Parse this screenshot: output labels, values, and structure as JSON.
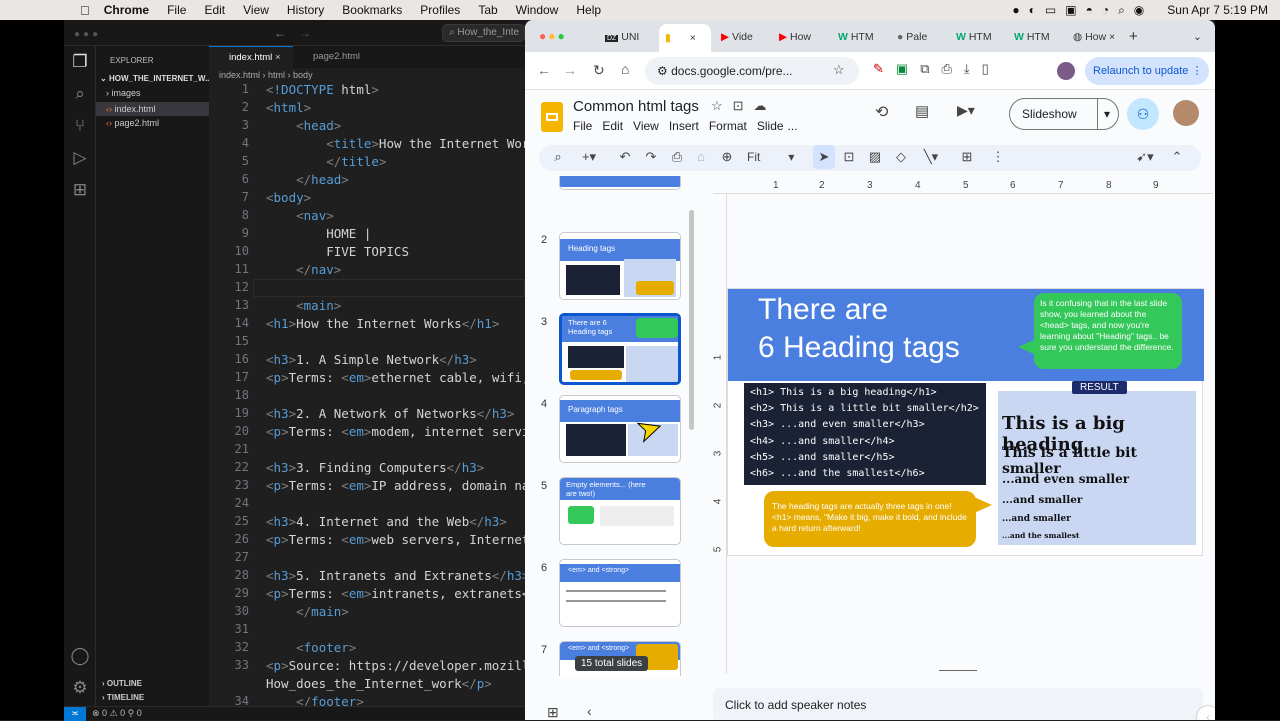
{
  "menubar": {
    "app": "Chrome",
    "items": [
      "File",
      "Edit",
      "View",
      "History",
      "Bookmarks",
      "Profiles",
      "Tab",
      "Window",
      "Help"
    ],
    "clock": "Sun Apr 7  5:19 PM"
  },
  "vscode": {
    "search": "How_the_Inte",
    "explorer_label": "EXPLORER",
    "folder": "HOW_THE_INTERNET_W...",
    "files": [
      "images",
      "index.html",
      "page2.html"
    ],
    "outline": "OUTLINE",
    "timeline": "TIMELINE",
    "tabs": [
      "index.html",
      "page2.html"
    ],
    "breadcrumb": [
      "index.html",
      "html",
      "body"
    ],
    "status": {
      "errors": "0",
      "warnings": "0",
      "ports": "0"
    },
    "lines": [
      {
        "n": "1",
        "t": "<!DOCTYPE html>"
      },
      {
        "n": "2",
        "t": "<html>"
      },
      {
        "n": "3",
        "t": "    <head>"
      },
      {
        "n": "4",
        "t": "        <title>How the Internet Work"
      },
      {
        "n": "5",
        "t": "        </title>"
      },
      {
        "n": "6",
        "t": "    </head>"
      },
      {
        "n": "7",
        "t": "<body>"
      },
      {
        "n": "8",
        "t": "    <nav>"
      },
      {
        "n": "9",
        "t": "        HOME |"
      },
      {
        "n": "10",
        "t": "        FIVE TOPICS"
      },
      {
        "n": "11",
        "t": "    </nav>"
      },
      {
        "n": "12",
        "t": ""
      },
      {
        "n": "13",
        "t": "    <main>"
      },
      {
        "n": "14",
        "t": "<h1>How the Internet Works</h1>"
      },
      {
        "n": "15",
        "t": ""
      },
      {
        "n": "16",
        "t": "<h3>1. A Simple Network</h3>"
      },
      {
        "n": "17",
        "t": "<p>Terms: <em>ethernet cable, wifi,"
      },
      {
        "n": "18",
        "t": ""
      },
      {
        "n": "19",
        "t": "<h3>2. A Network of Networks</h3>"
      },
      {
        "n": "20",
        "t": "<p>Terms: <em>modem, internet servic"
      },
      {
        "n": "21",
        "t": ""
      },
      {
        "n": "22",
        "t": "<h3>3. Finding Computers</h3>"
      },
      {
        "n": "23",
        "t": "<p>Terms: <em>IP address, domain nam"
      },
      {
        "n": "24",
        "t": ""
      },
      {
        "n": "25",
        "t": "<h3>4. Internet and the Web</h3>"
      },
      {
        "n": "26",
        "t": "<p>Terms: <em>web servers, Internet,"
      },
      {
        "n": "27",
        "t": ""
      },
      {
        "n": "28",
        "t": "<h3>5. Intranets and Extranets</h3>"
      },
      {
        "n": "29",
        "t": "<p>Terms: <em>intranets, extranets</"
      },
      {
        "n": "30",
        "t": "    </main>"
      },
      {
        "n": "31",
        "t": ""
      },
      {
        "n": "32",
        "t": "    <footer>"
      },
      {
        "n": "33",
        "t": "<p>Source: https://developer.mozill"
      },
      {
        "n": "",
        "t": "How_does_the_Internet_work</p>"
      },
      {
        "n": "34",
        "t": "    </footer>"
      }
    ]
  },
  "chrome": {
    "tabs": [
      "UNI",
      "",
      "Vide",
      "How",
      "HTM",
      "Pale",
      "HTM",
      "HTM",
      "How"
    ],
    "url": "docs.google.com/pre...",
    "relaunch": "Relaunch to update"
  },
  "slides": {
    "doc_title": "Common html tags",
    "menu": [
      "File",
      "Edit",
      "View",
      "Insert",
      "Format",
      "Slide",
      "..."
    ],
    "slideshow": "Slideshow",
    "zoom": "Fit",
    "ruler": [
      "1",
      "2",
      "3",
      "4",
      "5",
      "6",
      "7",
      "8",
      "9"
    ],
    "vruler": [
      "1",
      "2",
      "3",
      "4",
      "5"
    ],
    "thumbs": [
      {
        "n": "2",
        "title": "Heading tags"
      },
      {
        "n": "3",
        "title": "There are 6 Heading tags"
      },
      {
        "n": "4",
        "title": "Paragraph tags"
      },
      {
        "n": "5",
        "title": "Empty elements... (here are two!)"
      },
      {
        "n": "6",
        "title": "<em> and <strong>"
      },
      {
        "n": "7",
        "title": "<em> and <strong>"
      }
    ],
    "total_badge": "15 total slides",
    "notes": "Click to add speaker notes",
    "slide": {
      "title1": "There are",
      "title2": "6 Heading tags",
      "bubble": "Is it confusing that in the last slide show, you learned about the <head> tags, and now you're learning about \"Heading\" tags.. be sure you understand the difference.",
      "code": [
        "<h1> This is a big heading</h1>",
        "<h2> This is a little bit smaller</h2>",
        "<h3> ...and even smaller</h3>",
        "<h4> ...and smaller</h4>",
        "<h5> ...and smaller</h5>",
        "<h6> ...and the smallest</h6>"
      ],
      "result_label": "RESULT",
      "results": [
        "This is a big heading",
        "This is a little bit smaller",
        "...and even smaller",
        "...and smaller",
        "...and smaller",
        "...and the smallest"
      ],
      "note": "The heading tags are actually three tags in one! <h1> means, \"Make it big, make it bold, and include a hard return afterward!"
    }
  },
  "colors": {
    "accent": "#4285f4",
    "green": "#34c759",
    "yellow": "#e6ac00",
    "result_bg": "#c9d7f3"
  }
}
